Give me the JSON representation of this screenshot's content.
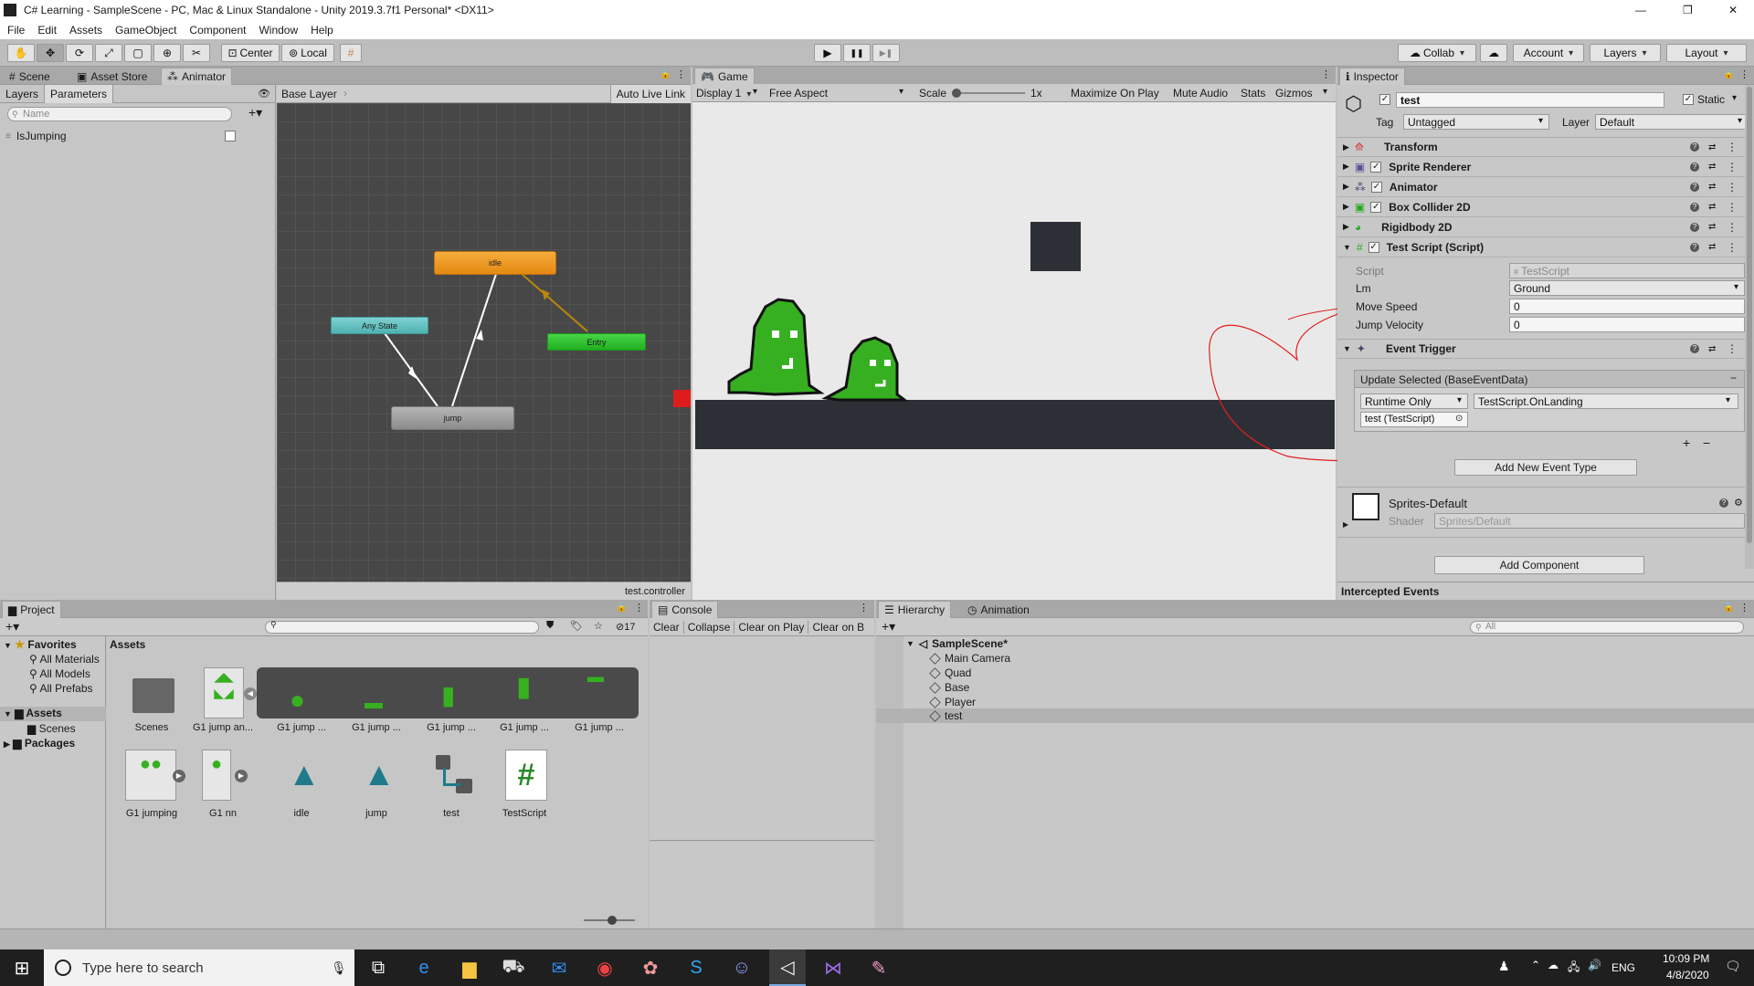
{
  "window": {
    "title": "C# Learning - SampleScene - PC, Mac & Linux Standalone - Unity 2019.3.7f1 Personal* <DX11>",
    "minimize": "—",
    "maximize": "❐",
    "close": "✕"
  },
  "menu": [
    "File",
    "Edit",
    "Assets",
    "GameObject",
    "Component",
    "Window",
    "Help"
  ],
  "toolbar": {
    "center_label": "Center",
    "local_label": "Local",
    "collab_label": "Collab",
    "account_label": "Account",
    "layers_label": "Layers",
    "layout_label": "Layout",
    "play": "▶",
    "pause": "❚❚",
    "step": "▶❚"
  },
  "left_tabs": {
    "scene": "Scene",
    "asset_store": "Asset Store",
    "animator": "Animator"
  },
  "animator": {
    "subtabs": {
      "layers": "Layers",
      "parameters": "Parameters"
    },
    "search_placeholder": "Name",
    "param_name": "IsJumping",
    "breadcrumb": "Base Layer",
    "auto_live_link": "Auto Live Link",
    "states": {
      "idle": "idle",
      "any_state": "Any State",
      "entry": "Entry",
      "jump": "jump"
    },
    "footer": "test.controller"
  },
  "game": {
    "tab": "Game",
    "display": "Display 1",
    "aspect": "Free Aspect",
    "scale_label": "Scale",
    "scale_value": "1x",
    "maximize": "Maximize On Play",
    "mute": "Mute Audio",
    "stats": "Stats",
    "gizmos": "Gizmos"
  },
  "inspector": {
    "tab": "Inspector",
    "object_name": "test",
    "static_label": "Static",
    "tag_label": "Tag",
    "tag_value": "Untagged",
    "layer_label": "Layer",
    "layer_value": "Default",
    "components": [
      "Transform",
      "Sprite Renderer",
      "Animator",
      "Box Collider 2D",
      "Rigidbody 2D",
      "Test Script (Script)"
    ],
    "script_fields": {
      "script_label": "Script",
      "script_value": "TestScript",
      "lm_label": "Lm",
      "lm_value": "Ground",
      "move_label": "Move Speed",
      "move_value": "0",
      "jump_label": "Jump Velocity",
      "jump_value": "0"
    },
    "event_trigger": {
      "title": "Event Trigger",
      "entry_header": "Update Selected (BaseEventData)",
      "runtime": "Runtime Only",
      "function": "TestScript.OnLanding",
      "target": "test (TestScript)",
      "plus": "+",
      "minus": "−",
      "add_new": "Add New Event Type"
    },
    "material": {
      "name": "Sprites-Default",
      "shader_label": "Shader",
      "shader_value": "Sprites/Default"
    },
    "add_component": "Add Component",
    "intercepted": "Intercepted Events"
  },
  "project": {
    "tab": "Project",
    "count": "17",
    "favorites": "Favorites",
    "fav_items": [
      "All Materials",
      "All Models",
      "All Prefabs"
    ],
    "assets_root": "Assets",
    "assets_children": [
      "Scenes"
    ],
    "packages": "Packages",
    "breadcrumb": "Assets",
    "row1": [
      "Scenes",
      "G1 jump an...",
      "G1 jump ...",
      "G1 jump ...",
      "G1 jump ...",
      "G1 jump ...",
      "G1 jump ..."
    ],
    "row2": [
      "G1 jumping",
      "G1 nn",
      "idle",
      "jump",
      "test",
      "TestScript"
    ]
  },
  "console": {
    "tab": "Console",
    "clear": "Clear",
    "collapse": "Collapse",
    "clear_on_play": "Clear on Play",
    "clear_on_build": "Clear on B"
  },
  "hierarchy": {
    "tab": "Hierarchy",
    "animation_tab": "Animation",
    "search_placeholder": "All",
    "scene": "SampleScene*",
    "items": [
      "Main Camera",
      "Quad",
      "Base",
      "Player",
      "test"
    ]
  },
  "taskbar": {
    "search_placeholder": "Type here to search",
    "lang": "ENG",
    "time": "10:09 PM",
    "date": "4/8/2020"
  },
  "colors": {
    "idle": "#f29a1e",
    "any_state": "#5fbfbf",
    "entry": "#2fc12f",
    "jump": "#9a9a9a",
    "slime": "#36b021",
    "annotation": "#e0201e"
  }
}
